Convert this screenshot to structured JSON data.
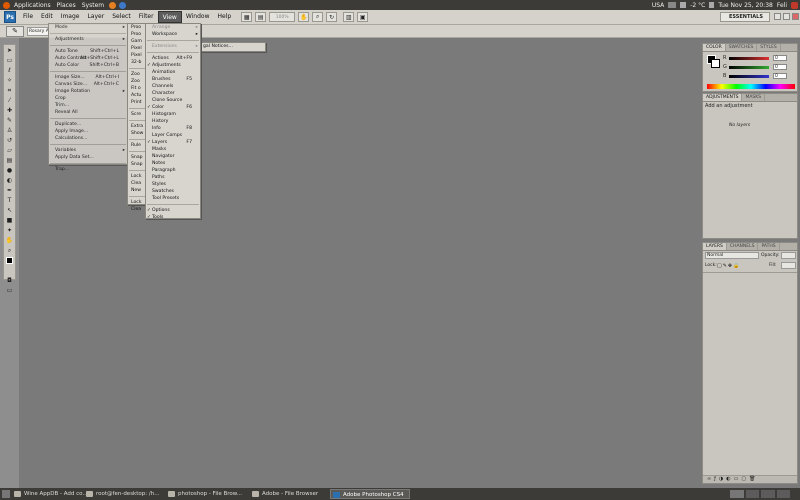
{
  "gnome_top": {
    "menus": [
      "Applications",
      "Places",
      "System"
    ],
    "keyboard": "USA",
    "weather": "-2 °C",
    "clock": "Tue Nov 25, 20:38",
    "user": "Feli"
  },
  "ps": {
    "logo": "Ps",
    "menus": [
      "File",
      "Edit",
      "Image",
      "Layer",
      "Select",
      "Filter",
      "View",
      "Window",
      "Help"
    ],
    "open_menu": "View",
    "zoom": "100%",
    "workspace": "ESSENTIALS",
    "options_label": "Rosary A",
    "submenu_text": "gal Notices..."
  },
  "image_menu": {
    "rows": [
      {
        "label": "Mode",
        "arrow": "▸"
      },
      {
        "sep": true
      },
      {
        "label": "Adjustments",
        "arrow": "▸"
      },
      {
        "sep": true
      },
      {
        "label": "Auto Tone",
        "shortcut": "Shift+Ctrl+L"
      },
      {
        "label": "Auto Contrast",
        "shortcut": "Alt+Shift+Ctrl+L"
      },
      {
        "label": "Auto Color",
        "shortcut": "Shift+Ctrl+B"
      },
      {
        "sep": true
      },
      {
        "label": "Image Size...",
        "shortcut": "Alt+Ctrl+I"
      },
      {
        "label": "Canvas Size...",
        "shortcut": "Alt+Ctrl+C"
      },
      {
        "label": "Image Rotation",
        "arrow": "▸"
      },
      {
        "label": "Crop"
      },
      {
        "label": "Trim..."
      },
      {
        "label": "Reveal All"
      },
      {
        "sep": true
      },
      {
        "label": "Duplicate..."
      },
      {
        "label": "Apply Image..."
      },
      {
        "label": "Calculations..."
      },
      {
        "sep": true
      },
      {
        "label": "Variables",
        "arrow": "▸"
      },
      {
        "label": "Apply Data Set..."
      },
      {
        "sep": true
      },
      {
        "label": "Trap..."
      }
    ]
  },
  "view_menu": {
    "rows": [
      "Proo",
      "Proo",
      "Gam",
      "Pixel",
      "Pixel",
      "32-b",
      "",
      "Zoo",
      "Zoo",
      "Fit o",
      "Actu",
      "Print",
      "",
      "Scre",
      "",
      "Extra",
      "Show",
      "",
      "Rule",
      "",
      "Snap",
      "Snap",
      "",
      "Lock",
      "Clea",
      "New",
      "",
      "Lock",
      "Clea"
    ]
  },
  "window_menu": {
    "rows": [
      {
        "label": "Arrange",
        "arrow": "▸",
        "dis": true
      },
      {
        "label": "Workspace",
        "arrow": "▸"
      },
      {
        "sep": true
      },
      {
        "label": "Extensions",
        "arrow": "▸",
        "dis": true
      },
      {
        "sep": true
      },
      {
        "label": "Actions",
        "shortcut": "Alt+F9"
      },
      {
        "label": "Adjustments",
        "check": true
      },
      {
        "label": "Animation"
      },
      {
        "label": "Brushes",
        "shortcut": "F5"
      },
      {
        "label": "Channels"
      },
      {
        "label": "Character"
      },
      {
        "label": "Clone Source"
      },
      {
        "label": "Color",
        "shortcut": "F6",
        "check": true
      },
      {
        "label": "Histogram"
      },
      {
        "label": "History"
      },
      {
        "label": "Info",
        "shortcut": "F8"
      },
      {
        "label": "Layer Comps"
      },
      {
        "label": "Layers",
        "shortcut": "F7",
        "check": true
      },
      {
        "label": "Masks"
      },
      {
        "label": "Navigator"
      },
      {
        "label": "Notes"
      },
      {
        "label": "Paragraph"
      },
      {
        "label": "Paths"
      },
      {
        "label": "Styles"
      },
      {
        "label": "Swatches"
      },
      {
        "label": "Tool Presets"
      },
      {
        "sep": true
      },
      {
        "label": "Options",
        "check": true
      },
      {
        "label": "Tools",
        "check": true
      }
    ]
  },
  "color_panel": {
    "tabs": [
      "COLOR",
      "SWATCHES",
      "STYLES"
    ],
    "channels": [
      {
        "name": "R",
        "value": "0",
        "color": "#d33"
      },
      {
        "name": "G",
        "value": "0",
        "color": "#3a3"
      },
      {
        "name": "B",
        "value": "0",
        "color": "#33c"
      }
    ]
  },
  "adjustments_panel": {
    "tabs": [
      "ADJUSTMENTS",
      "MASKS"
    ],
    "title": "Add an adjustment",
    "message": "No layers"
  },
  "layers_panel": {
    "tabs": [
      "LAYERS",
      "CHANNELS",
      "PATHS"
    ],
    "blend_mode": "Normal",
    "opacity_label": "Opacity:",
    "lock_label": "Lock:",
    "fill_label": "Fill:"
  },
  "taskbar": {
    "items": [
      {
        "label": "Wine AppDB - Add co..."
      },
      {
        "label": "root@fen-desktop: /h..."
      },
      {
        "label": "photoshop - File Brow..."
      },
      {
        "label": "Adobe - File Browser"
      },
      {
        "label": "Adobe Photoshop CS4",
        "active": true
      }
    ]
  }
}
